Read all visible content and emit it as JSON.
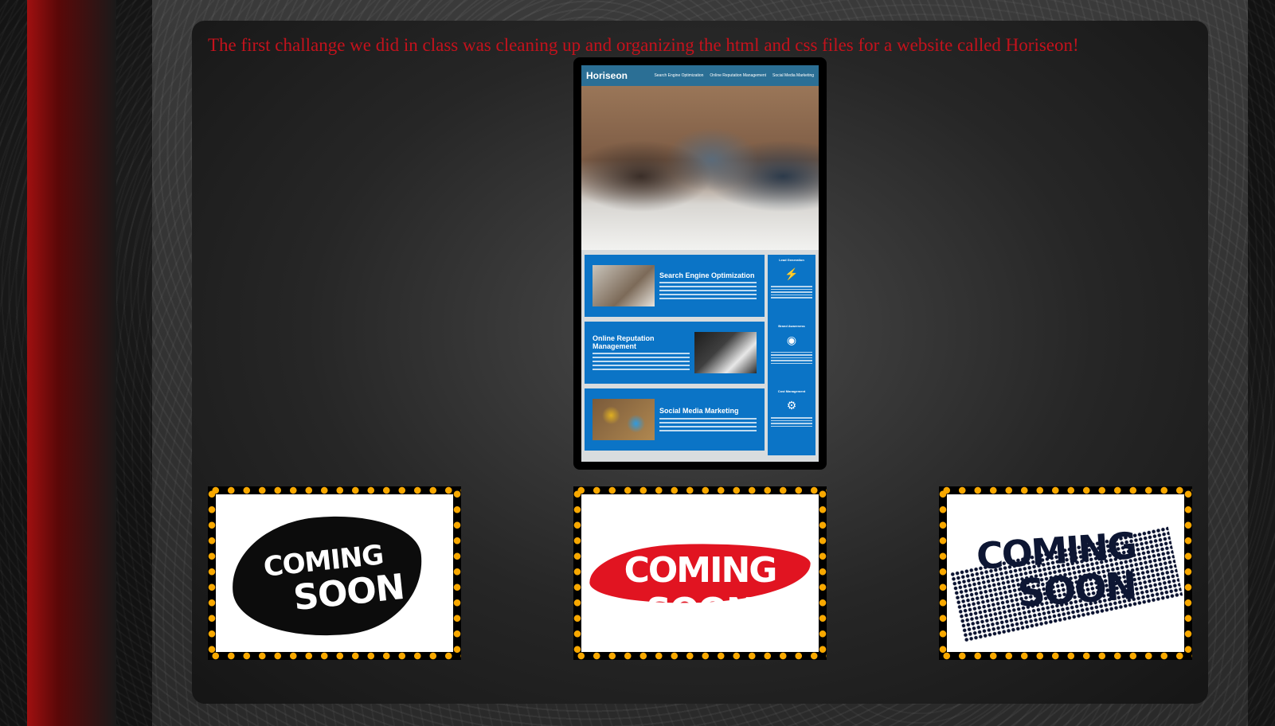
{
  "intro": {
    "text": "The first challange we did in class was cleaning up and organizing the html and css files for a website called Horiseon!"
  },
  "featured": {
    "site": {
      "logo": "Horiseon",
      "nav": [
        "Search Engine Optimization",
        "Online Reputation Management",
        "Social Media Marketing"
      ],
      "cards": [
        {
          "title": "Search Engine Optimization",
          "thumb": "seo-photo"
        },
        {
          "title": "Online Reputation Management",
          "thumb": "laptop-photo"
        },
        {
          "title": "Social Media Marketing",
          "thumb": "social-icons-photo"
        }
      ],
      "aside": [
        {
          "title": "Lead Generation",
          "icon": "lightbulb-icon"
        },
        {
          "title": "Brand Awareness",
          "icon": "broadcast-icon"
        },
        {
          "title": "Cost Management",
          "icon": "coins-icon"
        }
      ]
    }
  },
  "projects": [
    {
      "line1": "Coming",
      "line2": "Soon",
      "style": "black-splash"
    },
    {
      "line1": "Coming Soon",
      "style": "red-brush"
    },
    {
      "line1": "Coming",
      "line2": "Soon",
      "style": "navy-halftone"
    }
  ],
  "colors": {
    "intro_text": "#c4121c",
    "marquee_dots": "#f8a800",
    "site_blue": "#0b74c6",
    "side_bar_red": "#a01010"
  }
}
